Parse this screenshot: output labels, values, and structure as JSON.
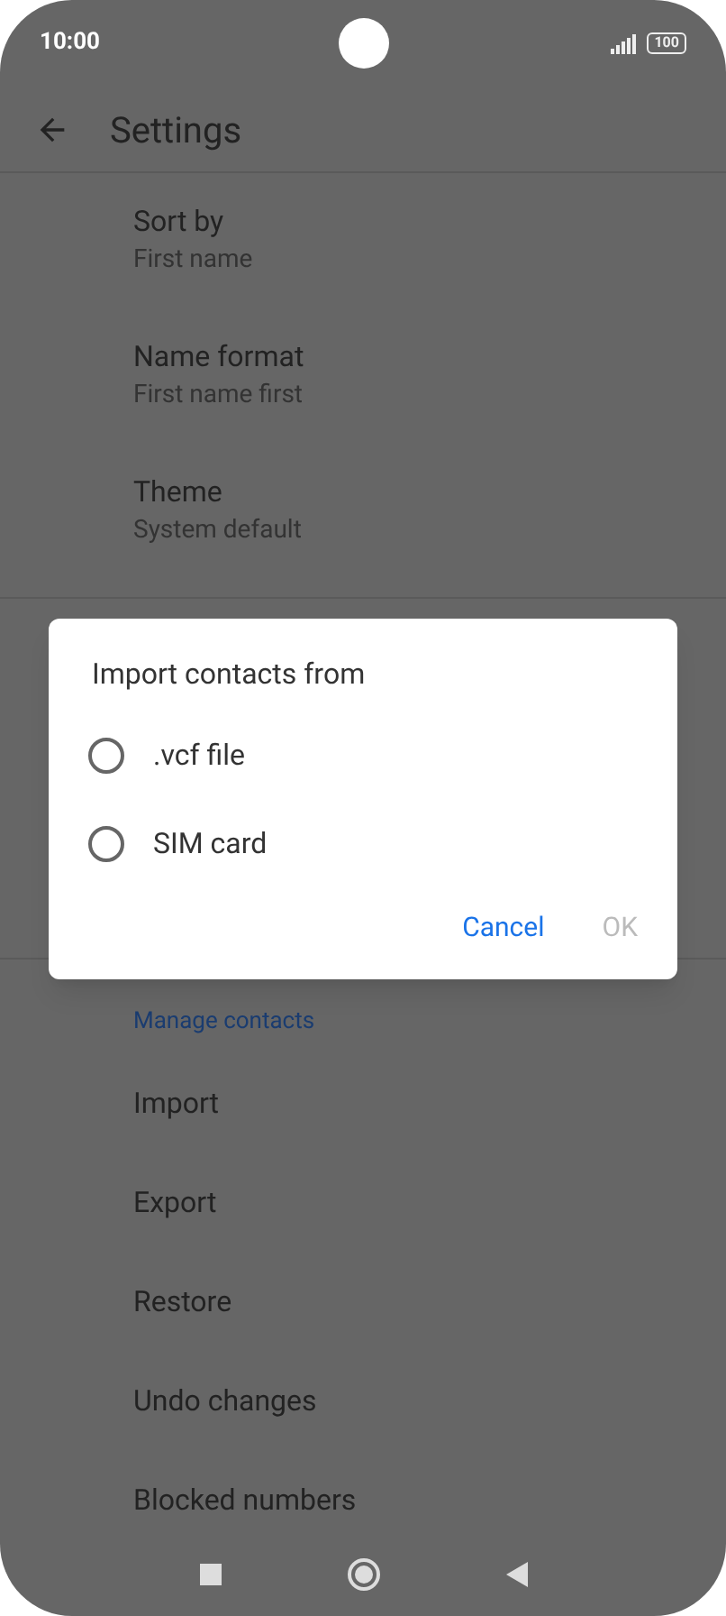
{
  "status_bar": {
    "time": "10:00",
    "battery": "100"
  },
  "app_bar": {
    "title": "Settings"
  },
  "settings": [
    {
      "title": "Sort by",
      "subtitle": "First name"
    },
    {
      "title": "Name format",
      "subtitle": "First name first"
    },
    {
      "title": "Theme",
      "subtitle": "System default"
    }
  ],
  "section": {
    "header": "Manage contacts",
    "items": [
      "Import",
      "Export",
      "Restore",
      "Undo changes",
      "Blocked numbers"
    ]
  },
  "dialog": {
    "title": "Import contacts from",
    "options": [
      {
        "label": ".vcf file",
        "selected": false
      },
      {
        "label": "SIM card",
        "selected": false
      }
    ],
    "buttons": [
      {
        "label": "Cancel",
        "disabled": false
      },
      {
        "label": "OK",
        "disabled": true
      }
    ]
  }
}
